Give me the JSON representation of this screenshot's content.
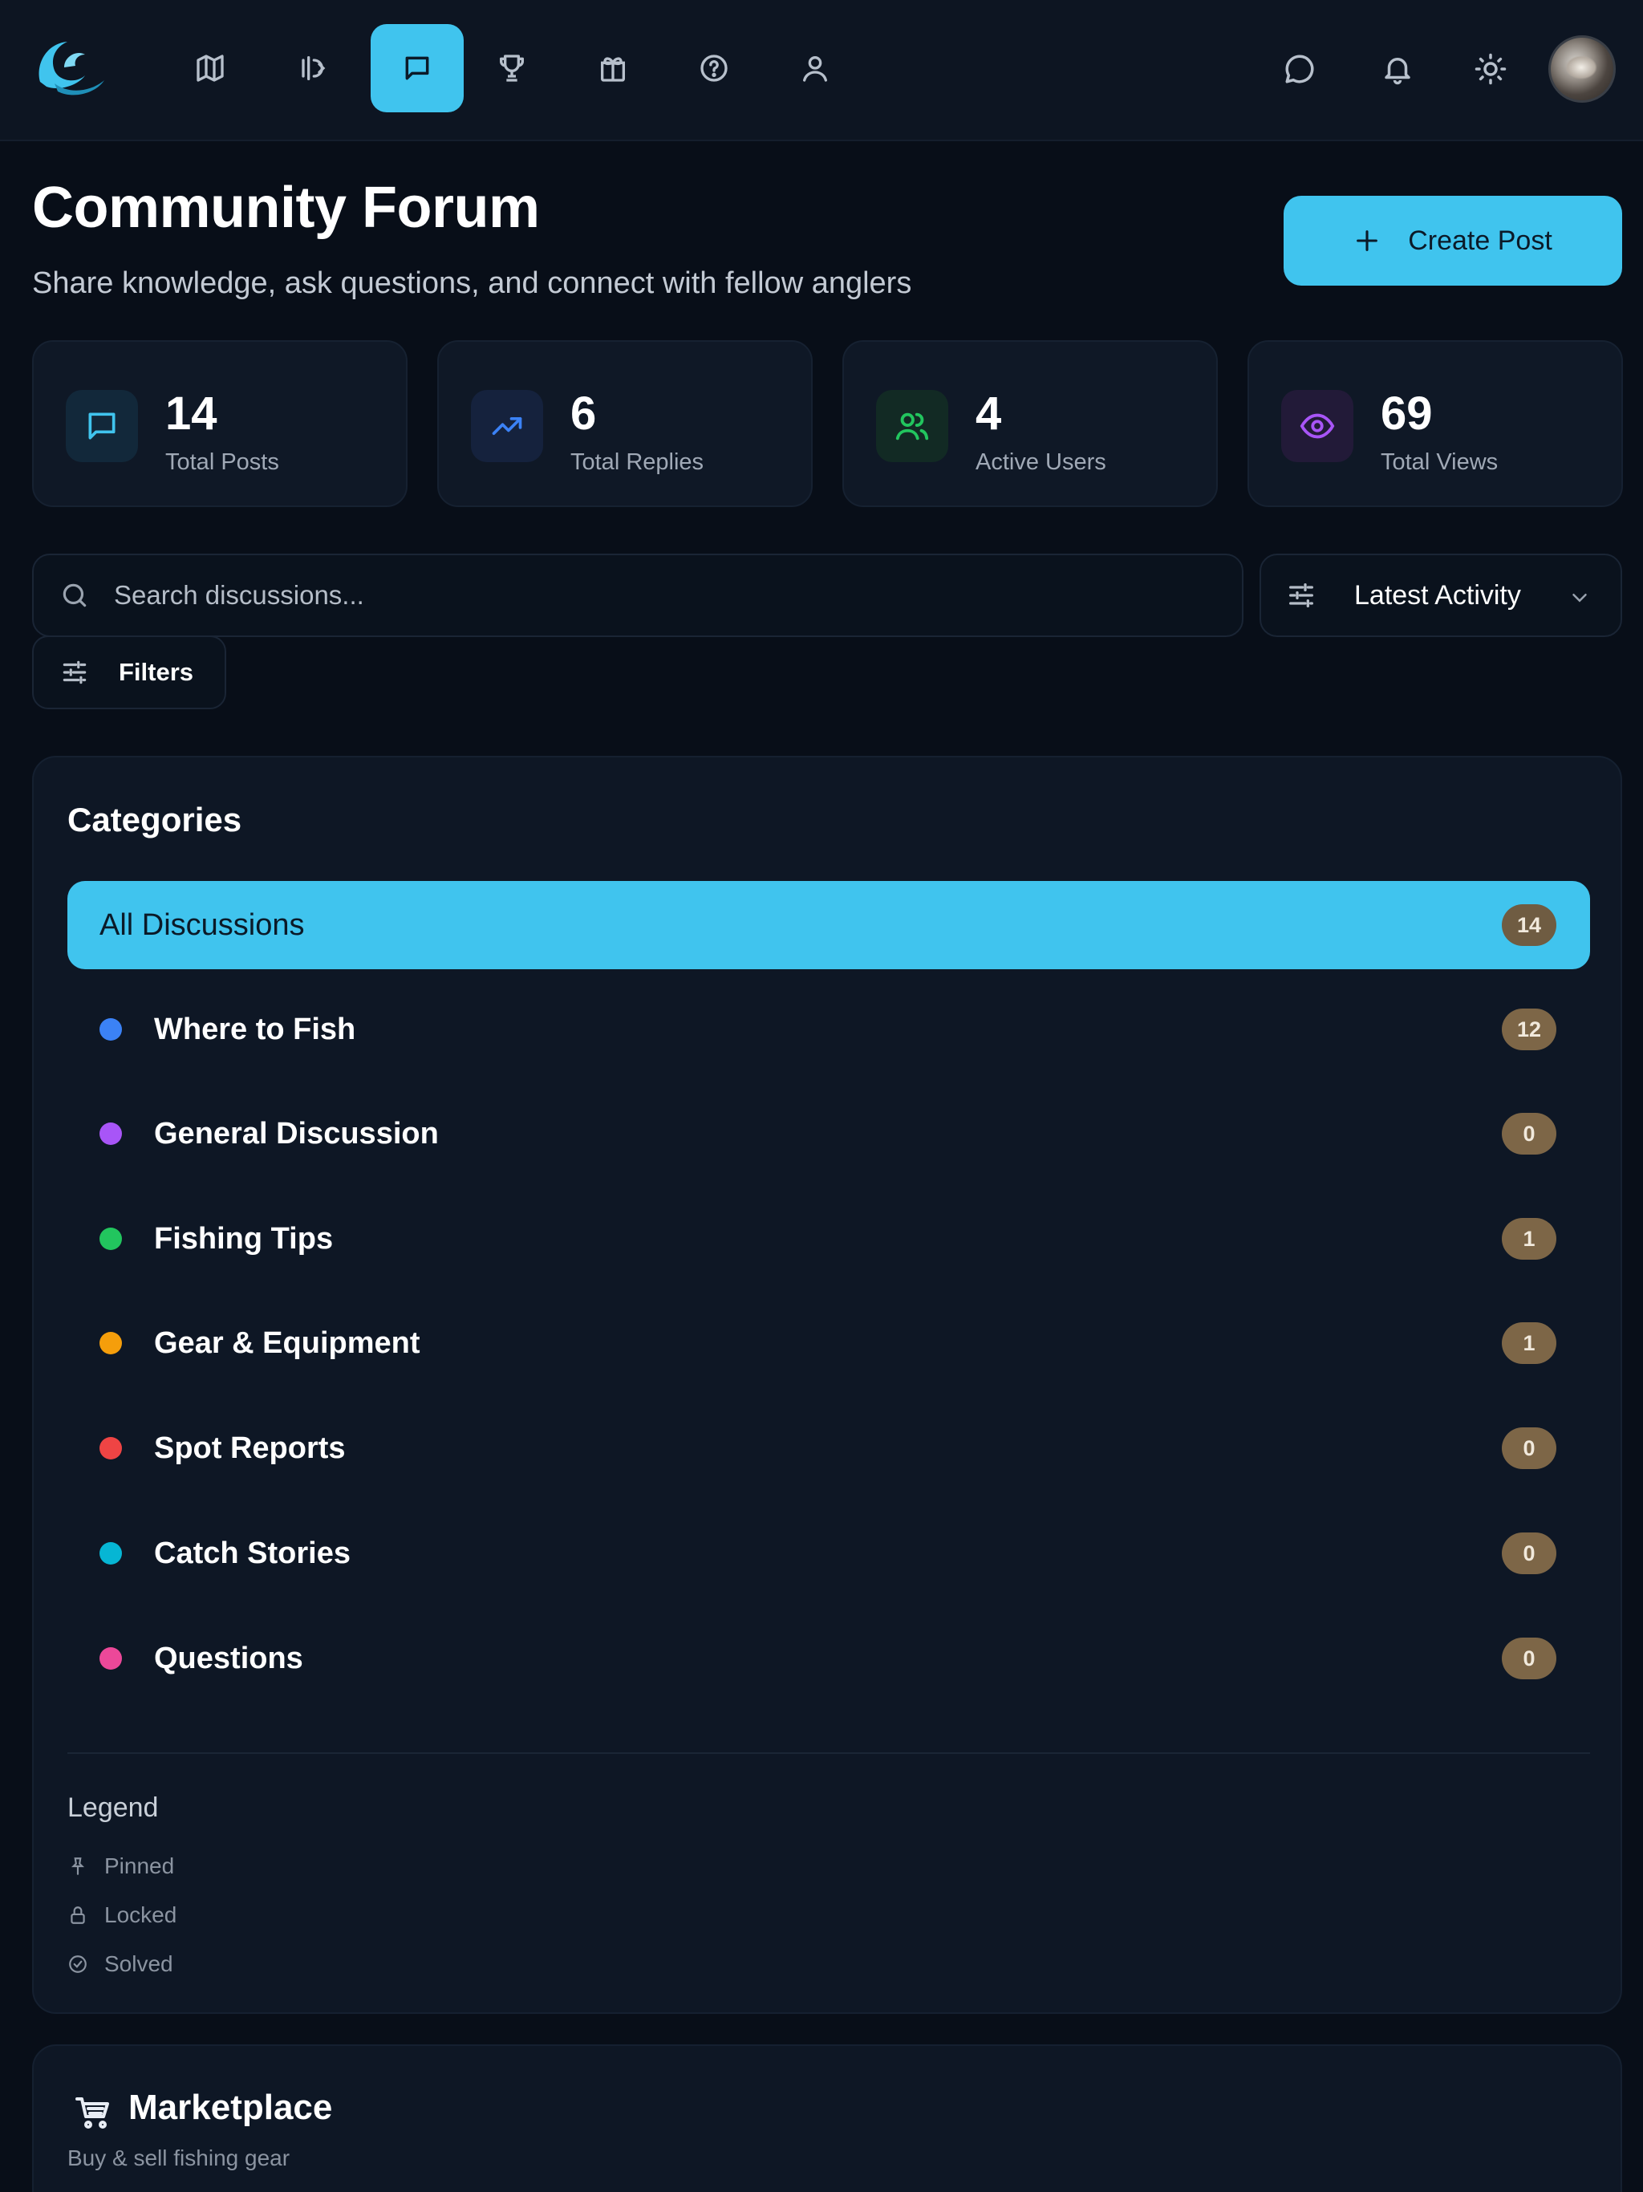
{
  "nav": {
    "items": [
      {
        "name": "map",
        "icon": "map-icon",
        "active": false
      },
      {
        "name": "fish",
        "icon": "fish-icon",
        "active": false
      },
      {
        "name": "forum",
        "icon": "message-square-icon",
        "active": true
      },
      {
        "name": "leaderboard",
        "icon": "trophy-icon",
        "active": false
      },
      {
        "name": "rewards",
        "icon": "gift-icon",
        "active": false
      },
      {
        "name": "help",
        "icon": "help-circle-icon",
        "active": false
      },
      {
        "name": "profile",
        "icon": "user-icon",
        "active": false
      }
    ],
    "right": [
      "chat-icon",
      "bell-icon",
      "sun-icon",
      "avatar"
    ]
  },
  "header": {
    "title": "Community Forum",
    "subtitle": "Share knowledge, ask questions, and connect with fellow anglers",
    "create_button": "Create Post"
  },
  "stats": [
    {
      "value": "14",
      "label": "Total Posts",
      "icon": "message-square-icon",
      "color": "#40c4ee"
    },
    {
      "value": "6",
      "label": "Total Replies",
      "icon": "trending-up-icon",
      "color": "#3b82f6"
    },
    {
      "value": "4",
      "label": "Active Users",
      "icon": "users-icon",
      "color": "#22c55e"
    },
    {
      "value": "69",
      "label": "Total Views",
      "icon": "eye-icon",
      "color": "#a855f7"
    }
  ],
  "search": {
    "placeholder": "Search discussions..."
  },
  "sort": {
    "selected": "Latest Activity"
  },
  "filters": {
    "label": "Filters"
  },
  "categories": {
    "title": "Categories",
    "items": [
      {
        "label": "All Discussions",
        "count": "14",
        "active": true
      },
      {
        "label": "Where to Fish",
        "count": "12",
        "color": "#3b82f6"
      },
      {
        "label": "General Discussion",
        "count": "0",
        "color": "#a855f7"
      },
      {
        "label": "Fishing Tips",
        "count": "1",
        "color": "#22c55e"
      },
      {
        "label": "Gear & Equipment",
        "count": "1",
        "color": "#f59e0b"
      },
      {
        "label": "Spot Reports",
        "count": "0",
        "color": "#ef4444"
      },
      {
        "label": "Catch Stories",
        "count": "0",
        "color": "#06b6d4"
      },
      {
        "label": "Questions",
        "count": "0",
        "color": "#ec4899"
      }
    ]
  },
  "legend": {
    "title": "Legend",
    "items": [
      {
        "label": "Pinned",
        "icon": "pin-icon"
      },
      {
        "label": "Locked",
        "icon": "lock-icon"
      },
      {
        "label": "Solved",
        "icon": "check-circle-icon"
      }
    ]
  },
  "marketplace": {
    "title": "Marketplace",
    "subtitle": "Buy & sell fishing gear"
  },
  "colors": {
    "accent": "#40c4ee",
    "background": "#080e18",
    "panel": "#0e1725",
    "badge": "#7d6647"
  }
}
